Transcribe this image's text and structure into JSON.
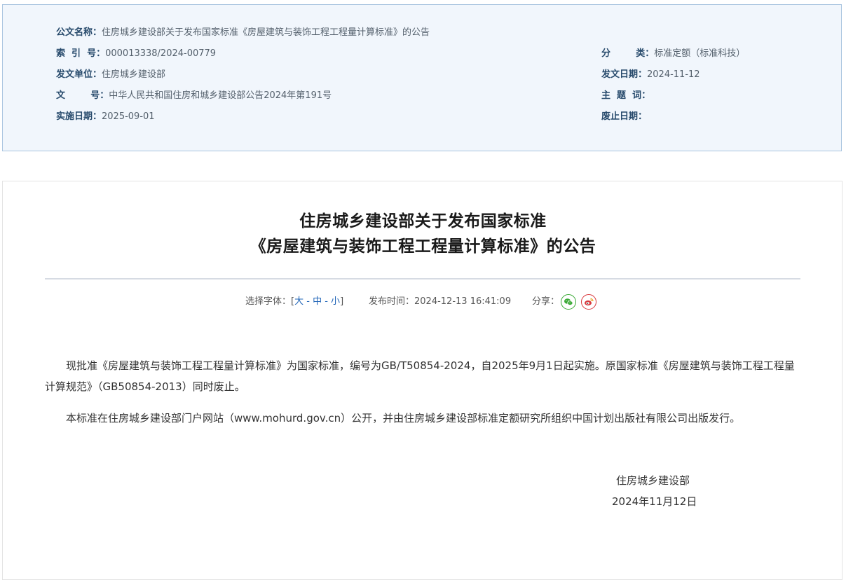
{
  "meta": {
    "doc_name_label": "公文名称：",
    "doc_name_value": "住房城乡建设部关于发布国家标准《房屋建筑与装饰工程工程量计算标准》的公告",
    "index_label": "索  引  号：",
    "index_value": "000013338/2024-00779",
    "category_label": "分        类：",
    "category_value": "标准定额（标准科技）",
    "issuer_label": "发文单位：",
    "issuer_value": "住房城乡建设部",
    "issue_date_label": "发文日期：",
    "issue_date_value": "2024-11-12",
    "doc_number_label": "文        号：",
    "doc_number_value": "中华人民共和国住房和城乡建设部公告2024年第191号",
    "keywords_label": "主  题  词：",
    "keywords_value": "",
    "effective_date_label": "实施日期：",
    "effective_date_value": "2025-09-01",
    "repeal_date_label": "废止日期：",
    "repeal_date_value": ""
  },
  "article": {
    "title_line1": "住房城乡建设部关于发布国家标准",
    "title_line2": "《房屋建筑与装饰工程工程量计算标准》的公告",
    "toolbar": {
      "font_select_label": "选择字体：[",
      "font_large": "大",
      "sep1": " - ",
      "font_medium": "中",
      "sep2": " - ",
      "font_small": "小",
      "font_close": "]",
      "publish_time_label": "发布时间：",
      "publish_time_value": "2024-12-13 16:41:09",
      "share_label": "分享："
    },
    "paragraph1": "现批准《房屋建筑与装饰工程工程量计算标准》为国家标准，编号为GB/T50854-2024，自2025年9月1日起实施。原国家标准《房屋建筑与装饰工程工程量计算规范》（GB50854-2013）同时废止。",
    "paragraph2": "本标准在住房城乡建设部门户网站（www.mohurd.gov.cn）公开，并由住房城乡建设部标准定额研究所组织中国计划出版社有限公司出版发行。",
    "signature_org": "住房城乡建设部",
    "signature_date": "2024年11月12日"
  },
  "colors": {
    "meta_background": "#f1f6fc",
    "meta_border": "#aac5e0",
    "link_blue": "#1f64b7",
    "wechat_green": "#3aa935",
    "weibo_red": "#d9373c"
  },
  "icons": {
    "share_wechat": "wechat-icon",
    "share_weibo": "weibo-icon"
  }
}
